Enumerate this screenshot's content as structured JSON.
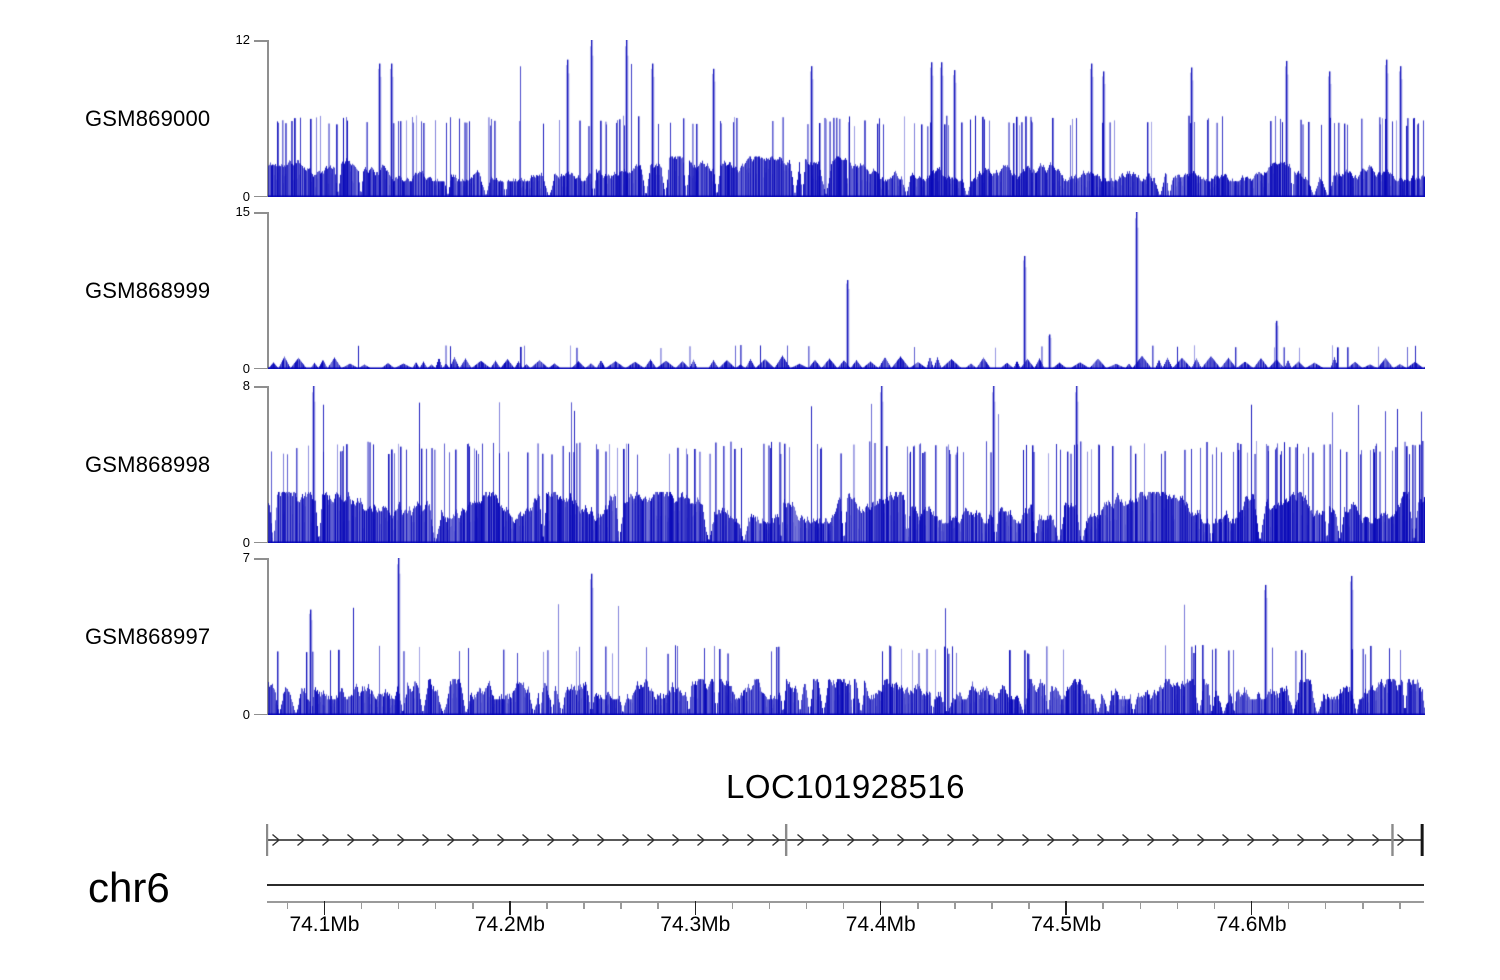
{
  "figure": {
    "background": "#ffffff",
    "kind": "genome-coverage-browser-view"
  },
  "chart_data": {
    "type": "area",
    "description": "Four read-coverage tracks (filled blue signal) over a chr6 region with a gene model and genomic coordinate axis",
    "panels": [
      {
        "label": "GSM869000",
        "ylim": [
          0,
          12
        ],
        "yticks": [
          0,
          12
        ],
        "seed": 11,
        "style": "dense",
        "base": {
          "mean": 2.4,
          "min": 1.2,
          "max": 3.1
        },
        "dip_p": 0.016,
        "mid_spike": {
          "p": 0.12,
          "h": 6
        },
        "tall_spike": {
          "p": 0.004,
          "h": 10
        },
        "big_spikes": [
          {
            "frac": 0.279,
            "h": 12
          },
          {
            "frac": 0.309,
            "h": 12
          },
          {
            "frac": 0.096,
            "h": 10.2
          },
          {
            "frac": 0.106,
            "h": 10.2
          },
          {
            "frac": 0.258,
            "h": 10.5
          },
          {
            "frac": 0.332,
            "h": 10.2
          },
          {
            "frac": 0.385,
            "h": 9.8
          },
          {
            "frac": 0.469,
            "h": 10.0
          },
          {
            "frac": 0.573,
            "h": 10.3
          },
          {
            "frac": 0.582,
            "h": 10.3
          },
          {
            "frac": 0.593,
            "h": 9.7
          },
          {
            "frac": 0.711,
            "h": 10.2
          },
          {
            "frac": 0.722,
            "h": 9.6
          },
          {
            "frac": 0.798,
            "h": 9.9
          },
          {
            "frac": 0.88,
            "h": 10.4
          },
          {
            "frac": 0.917,
            "h": 9.6
          },
          {
            "frac": 0.966,
            "h": 10.5
          },
          {
            "frac": 0.978,
            "h": 10.0
          }
        ]
      },
      {
        "label": "GSM868999",
        "ylim": [
          0,
          15
        ],
        "yticks": [
          0,
          15
        ],
        "seed": 22,
        "style": "bumps",
        "base": {
          "mean": 0.75,
          "min": 0,
          "max": 1.3
        },
        "dip_p": 0.1,
        "mid_spike": {
          "p": 0.022,
          "h": 2.2
        },
        "tall_spike": {
          "p": 0,
          "h": 0
        },
        "big_spikes": [
          {
            "frac": 0.5,
            "h": 8.5
          },
          {
            "frac": 0.653,
            "h": 10.8
          },
          {
            "frac": 0.75,
            "h": 15
          },
          {
            "frac": 0.871,
            "h": 4.6
          },
          {
            "frac": 0.675,
            "h": 3.3
          }
        ]
      },
      {
        "label": "GSM868998",
        "ylim": [
          0,
          8
        ],
        "yticks": [
          0,
          8
        ],
        "seed": 33,
        "style": "dense",
        "base": {
          "mean": 2.0,
          "min": 1.0,
          "max": 2.6
        },
        "dip_p": 0.018,
        "mid_spike": {
          "p": 0.17,
          "h": 5
        },
        "tall_spike": {
          "p": 0.012,
          "h": 7
        },
        "big_spikes": [
          {
            "frac": 0.039,
            "h": 8
          },
          {
            "frac": 0.53,
            "h": 8
          },
          {
            "frac": 0.627,
            "h": 8
          },
          {
            "frac": 0.698,
            "h": 8
          }
        ]
      },
      {
        "label": "GSM868997",
        "ylim": [
          0,
          7
        ],
        "yticks": [
          0,
          7
        ],
        "seed": 44,
        "style": "block",
        "base": {
          "mean": 1.3,
          "min": 0.7,
          "max": 1.6
        },
        "dip_p": 0.035,
        "mid_spike": {
          "p": 0.055,
          "h": 3
        },
        "tall_spike": {
          "p": 0.007,
          "h": 4.8
        },
        "big_spikes": [
          {
            "frac": 0.112,
            "h": 7
          },
          {
            "frac": 0.279,
            "h": 6.3
          },
          {
            "frac": 0.036,
            "h": 4.7
          },
          {
            "frac": 0.862,
            "h": 5.8
          },
          {
            "frac": 0.936,
            "h": 6.2
          }
        ]
      }
    ],
    "xaxis": {
      "chromosome": "chr6",
      "unit": "Mb",
      "start_mb": 74.069,
      "end_mb": 74.693,
      "major_ticks": [
        {
          "pos": 74.1,
          "label": "74.1Mb"
        },
        {
          "pos": 74.2,
          "label": "74.2Mb"
        },
        {
          "pos": 74.3,
          "label": "74.3Mb"
        },
        {
          "pos": 74.4,
          "label": "74.4Mb"
        },
        {
          "pos": 74.5,
          "label": "74.5Mb"
        },
        {
          "pos": 74.6,
          "label": "74.6Mb"
        }
      ],
      "minor_tick_start": 74.08,
      "minor_tick_end": 74.68,
      "minor_tick_step": 0.02
    },
    "gene": {
      "name": "LOC101928516",
      "strand": "forward",
      "start_mb": 74.069,
      "end_mb": 74.692,
      "arrow_spacing_px": 25,
      "exon_marks": [
        {
          "pos": 74.069,
          "tone": "gray"
        },
        {
          "pos": 74.349,
          "tone": "gray"
        },
        {
          "pos": 74.676,
          "tone": "gray"
        },
        {
          "pos": 74.692,
          "tone": "black"
        }
      ]
    },
    "colors": {
      "signal": "#0808b8",
      "axis_gray": "#8f8f8f",
      "scale_line": "#2b2b2b",
      "tick_gray": "#9a9a9a",
      "gene_line": "#222222",
      "arrow": "#333333",
      "exon_gray": "#8a8a8a",
      "exon_black": "#151515",
      "text": "#000000"
    },
    "legend": null,
    "grid": false
  }
}
